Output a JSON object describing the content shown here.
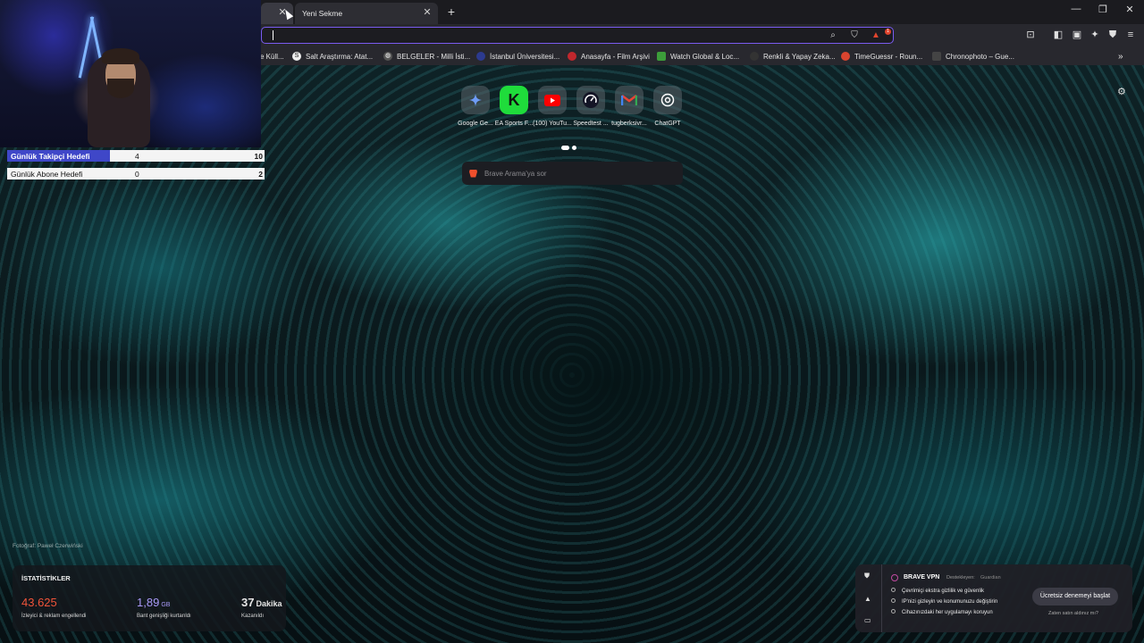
{
  "browser": {
    "tabs": [
      {
        "label": ""
      },
      {
        "label": "Yeni Sekme"
      }
    ],
    "shield_badge": "1"
  },
  "bookmarks": [
    {
      "label": "e Küll..."
    },
    {
      "label": "Salt Araştırma: Atat..."
    },
    {
      "label": "BELGELER - Milli İsti..."
    },
    {
      "label": "İstanbul Üniversitesi..."
    },
    {
      "label": "Anasayfa - Film Arşivi"
    },
    {
      "label": "Watch Global & Loc..."
    },
    {
      "label": "Renkli & Yapay Zeka..."
    },
    {
      "label": "TimeGuessr - Roun..."
    },
    {
      "label": "Chronophoto – Gue..."
    }
  ],
  "stream_goals": [
    {
      "label": "Günlük Takipçi Hedefi",
      "current": "4",
      "target": "10",
      "progress": 0.4
    },
    {
      "label": "Günlük Abone Hedefi",
      "current": "0",
      "target": "2",
      "progress": 0
    }
  ],
  "top_sites": [
    {
      "name": "Google Ge...",
      "icon": "gemini-icon",
      "color": "#4f8cf7"
    },
    {
      "name": "EA Sports F...",
      "icon": "ea-sports-icon",
      "color": "#1fdc3b"
    },
    {
      "name": "(100) YouTu...",
      "icon": "youtube-icon",
      "color": "#ff0000"
    },
    {
      "name": "Speedtest ...",
      "icon": "speedtest-icon",
      "color": "#141526"
    },
    {
      "name": "tugberksivr...",
      "icon": "gmail-icon",
      "color": "#ea4335"
    },
    {
      "name": "ChatGPT",
      "icon": "chatgpt-icon",
      "color": "#ffffff"
    }
  ],
  "search": {
    "placeholder": "Brave Arama'ya sor"
  },
  "photo_credit": "Fotoğraf: Paweł Czerwiński",
  "stats": {
    "heading": "İSTATİSTİKLER",
    "trackers": {
      "value": "43.625",
      "desc": "İzleyici & reklam engellendi",
      "color": "#f0543a"
    },
    "bandwidth": {
      "value": "1,89",
      "unit": "GB",
      "desc": "Bant genişliği kurtarıldı",
      "color": "#a99af8"
    },
    "time": {
      "value": "37",
      "unit": "Dakika",
      "desc": "Kazanıldı"
    }
  },
  "vpn": {
    "title": "BRAVE VPN",
    "supported_by": "Destekleyen:",
    "provider": "Guardian",
    "features": [
      "Çevrimiçi ekstra gizlilik ve güvenlik",
      "IP'nizi gizleyin ve konumunuzu değiştirin",
      "Cihazınızdaki her uygulamayı koruyun"
    ],
    "cta": "Ücretsiz denemeyi başlat",
    "already": "Zaten satın aldınız mı?"
  }
}
